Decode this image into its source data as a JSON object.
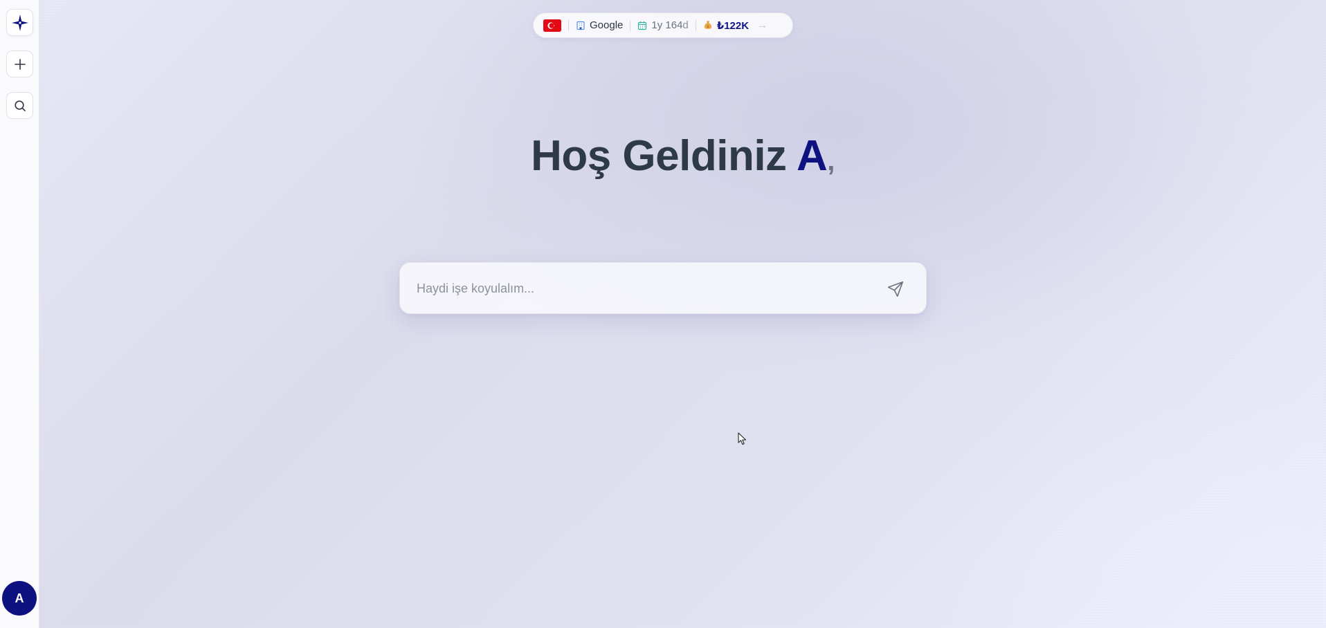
{
  "sidebar": {
    "logo_icon": "sparkle-star-logo",
    "new_icon": "plus-icon",
    "search_icon": "search-icon",
    "avatar_initial": "A"
  },
  "topbar": {
    "country_flag": "turkey-flag",
    "company": "Google",
    "tenure": "1y 164d",
    "tenure_main": "1y 164",
    "tenure_suffix": "d",
    "salary": "₺122K",
    "arrow": "→"
  },
  "greeting": {
    "text": "Hoş Geldiniz",
    "name": "A",
    "comma": ","
  },
  "prompt": {
    "placeholder": "Haydi işe koyulalım...",
    "value": ""
  },
  "colors": {
    "accent": "#0e1180",
    "flag_red": "#e30a17"
  }
}
